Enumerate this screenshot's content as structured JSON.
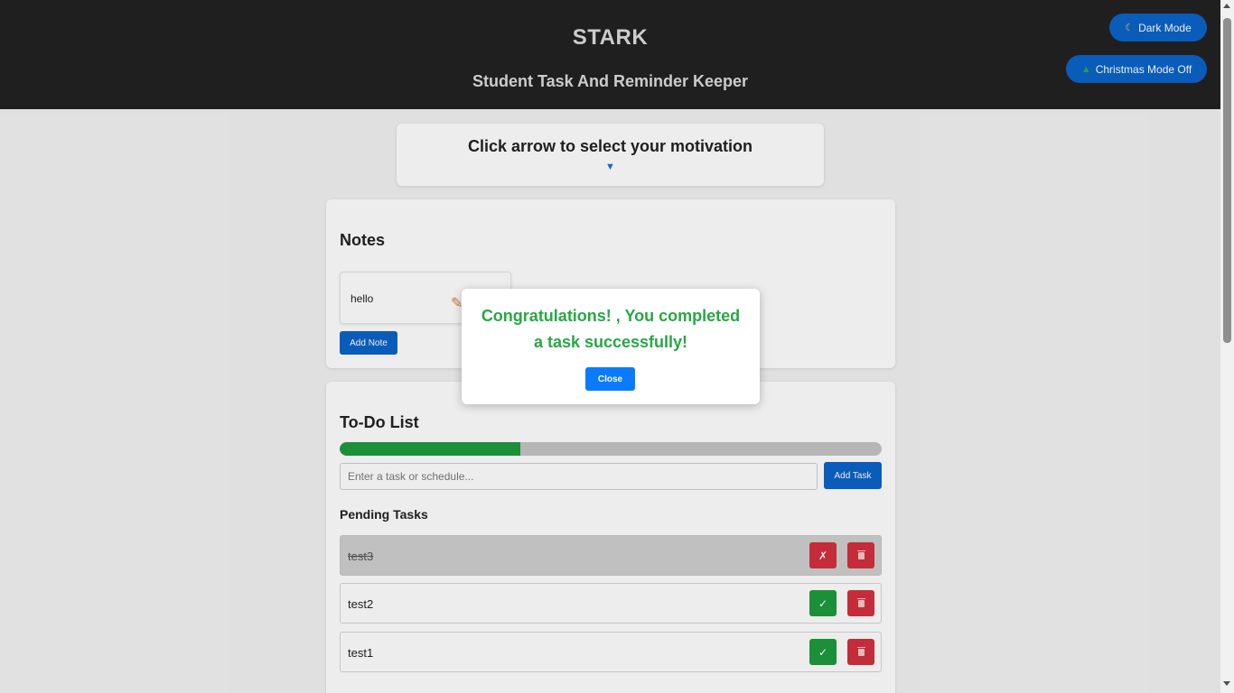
{
  "header": {
    "title": "STARK",
    "subtitle": "Student Task And Reminder Keeper",
    "dark_mode_label": "Dark Mode",
    "christmas_mode_label": "Christmas Mode Off"
  },
  "motivation": {
    "title": "Click arrow to select your motivation",
    "arrow": "▼"
  },
  "notes": {
    "title": "Notes",
    "items": [
      {
        "text": "hello"
      }
    ],
    "add_label": "Add Note"
  },
  "todo": {
    "title": "To-Do List",
    "progress_fraction": 0.333,
    "input_placeholder": "Enter a task or schedule...",
    "add_label": "Add Task",
    "pending_title": "Pending Tasks",
    "tasks": [
      {
        "label": "test3",
        "done": true,
        "toggle_symbol": "✗"
      },
      {
        "label": "test2",
        "done": false,
        "toggle_symbol": "✓"
      },
      {
        "label": "test1",
        "done": false,
        "toggle_symbol": "✓"
      }
    ]
  },
  "modal": {
    "message": "Congratulations! , You completed a task successfully!",
    "close_label": "Close"
  },
  "colors": {
    "header_bg": "#222222",
    "primary": "#0b63c9",
    "success": "#28a745",
    "danger": "#d3303f"
  }
}
